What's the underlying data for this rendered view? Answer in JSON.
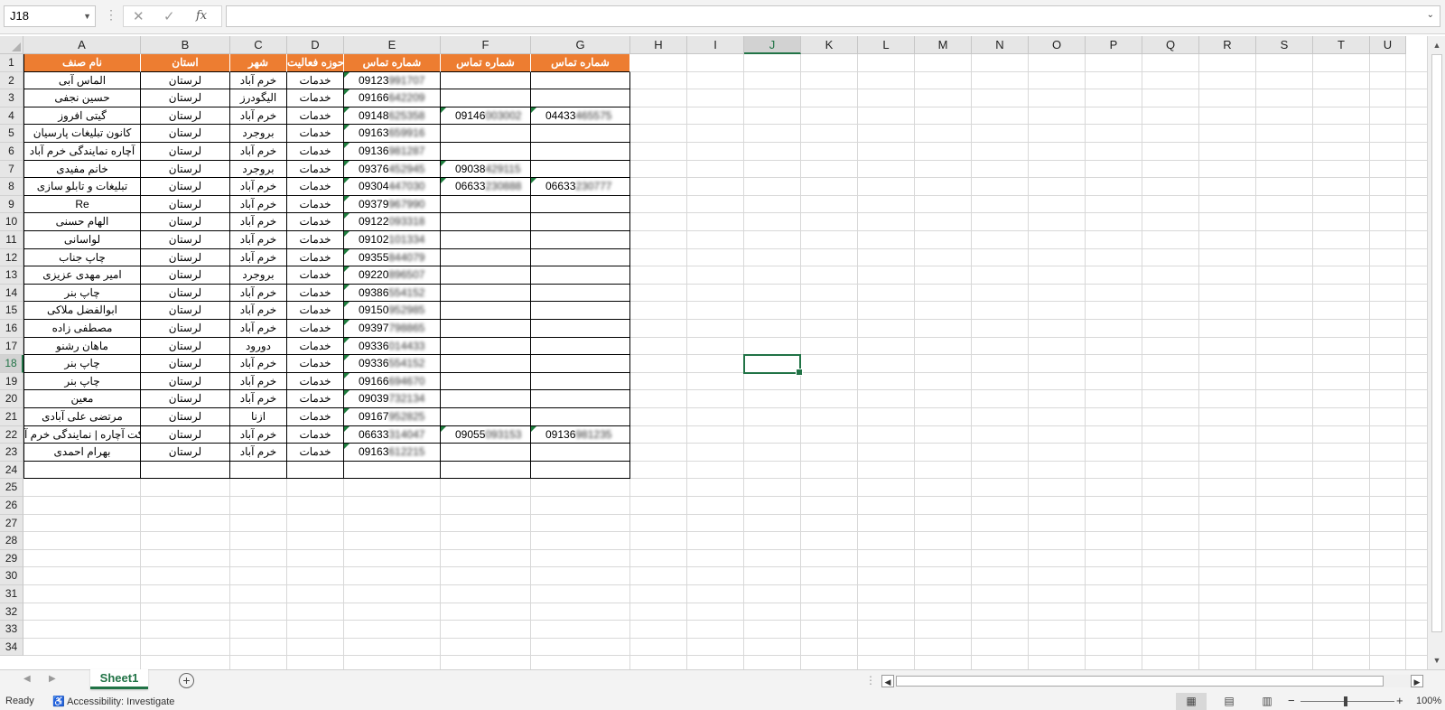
{
  "formula_bar": {
    "name_box": "J18",
    "cancel_icon": "✕",
    "enter_icon": "✓",
    "function_icon": "fx",
    "formula": ""
  },
  "columns": [
    "A",
    "B",
    "C",
    "D",
    "E",
    "F",
    "G",
    "H",
    "I",
    "J",
    "K",
    "L",
    "M",
    "N",
    "O",
    "P",
    "Q",
    "R",
    "S",
    "T",
    "U"
  ],
  "selected_column": "J",
  "selected_row": 18,
  "row_numbers": [
    1,
    2,
    3,
    4,
    5,
    6,
    7,
    8,
    9,
    10,
    11,
    12,
    13,
    14,
    15,
    16,
    17,
    18,
    19,
    20,
    21,
    22,
    23,
    24,
    25,
    26,
    27,
    28,
    29,
    30,
    31,
    32,
    33,
    34
  ],
  "table": {
    "headers": [
      "نام صنف",
      "استان",
      "شهر",
      "حوزه فعالیت",
      "شماره تماس",
      "شماره تماس",
      "شماره تماس"
    ],
    "rows": [
      [
        "الماس آبی",
        "لرستان",
        "خرم آباد",
        "خدمات",
        "09123991707",
        "",
        ""
      ],
      [
        "حسین نجفی",
        "لرستان",
        "الیگودرز",
        "خدمات",
        "09166642209",
        "",
        ""
      ],
      [
        "گیتی افروز",
        "لرستان",
        "خرم آباد",
        "خدمات",
        "09148625358",
        "09146003002",
        "04433465575"
      ],
      [
        "کانون تبلیغات پارسیان",
        "لرستان",
        "بروجرد",
        "خدمات",
        "09163659916",
        "",
        ""
      ],
      [
        "آچاره نمایندگی خرم آباد",
        "لرستان",
        "خرم آباد",
        "خدمات",
        "09136981287",
        "",
        ""
      ],
      [
        "خانم مفیدی",
        "لرستان",
        "بروجرد",
        "خدمات",
        "09376452945",
        "09038429115",
        ""
      ],
      [
        "تبلیغات و تابلو سازی",
        "لرستان",
        "خرم آباد",
        "خدمات",
        "09304447030",
        "06633230888",
        "06633230777"
      ],
      [
        "Re",
        "لرستان",
        "خرم آباد",
        "خدمات",
        "09379967990",
        "",
        ""
      ],
      [
        "الهام حسنی",
        "لرستان",
        "خرم آباد",
        "خدمات",
        "09122093318",
        "",
        ""
      ],
      [
        "لواسانی",
        "لرستان",
        "خرم آباد",
        "خدمات",
        "09102101334",
        "",
        ""
      ],
      [
        "چاپ جناب",
        "لرستان",
        "خرم آباد",
        "خدمات",
        "09355844079",
        "",
        ""
      ],
      [
        "امیر مهدی عزیزی",
        "لرستان",
        "بروجرد",
        "خدمات",
        "09220896507",
        "",
        ""
      ],
      [
        "چاپ بنر",
        "لرستان",
        "خرم آباد",
        "خدمات",
        "09386554152",
        "",
        ""
      ],
      [
        "ابوالفضل ملاکی",
        "لرستان",
        "خرم آباد",
        "خدمات",
        "09150952985",
        "",
        ""
      ],
      [
        "مصطفی زاده",
        "لرستان",
        "خرم آباد",
        "خدمات",
        "09397798865",
        "",
        ""
      ],
      [
        "ماهان رشنو",
        "لرستان",
        "دورود",
        "خدمات",
        "09336014433",
        "",
        ""
      ],
      [
        "چاپ بنر",
        "لرستان",
        "خرم آباد",
        "خدمات",
        "09336554152",
        "",
        ""
      ],
      [
        "چاپ بنر",
        "لرستان",
        "خرم آباد",
        "خدمات",
        "09166694670",
        "",
        ""
      ],
      [
        "معین",
        "لرستان",
        "خرم آباد",
        "خدمات",
        "09039732134",
        "",
        ""
      ],
      [
        "مرتضی علی آبادی",
        "لرستان",
        "ازنا",
        "خدمات",
        "09167952825",
        "",
        ""
      ],
      [
        "کت آچاره | نمایندگی خرم آ",
        "لرستان",
        "خرم آباد",
        "خدمات",
        "06633314047",
        "09055093153",
        "09136981235"
      ],
      [
        "بهرام احمدی",
        "لرستان",
        "خرم آباد",
        "خدمات",
        "09163612215",
        "",
        ""
      ],
      [
        "",
        "",
        "",
        "",
        "",
        "",
        ""
      ]
    ]
  },
  "sheet_tabs": {
    "active": "Sheet1",
    "add_icon": "+"
  },
  "status_bar": {
    "ready": "Ready",
    "accessibility": "Accessibility: Investigate",
    "zoom": "100%",
    "zoom_minus": "−",
    "zoom_plus": "+"
  },
  "colors": {
    "header_fill": "#ed7d31",
    "accent": "#217346"
  }
}
